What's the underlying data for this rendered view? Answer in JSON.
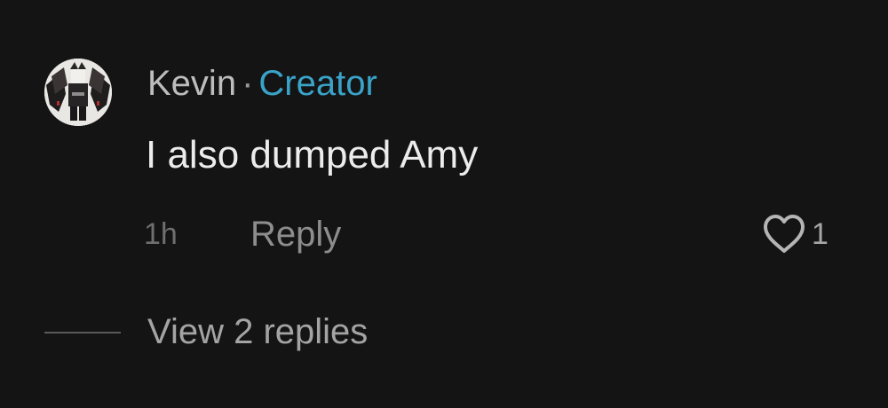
{
  "comment": {
    "author": "Kevin",
    "separator": "·",
    "role_badge": "Creator",
    "text": "I also dumped Amy",
    "timestamp": "1h",
    "reply_label": "Reply",
    "like_count": "1",
    "like_icon": "heart-outline-icon",
    "view_replies_label": "View 2 replies"
  },
  "colors": {
    "background": "#141414",
    "author": "#bdbdbd",
    "role_badge": "#3aa3c9",
    "comment_text": "#ececec",
    "muted": "#6f6f6f",
    "reply": "#8d8d8d"
  }
}
